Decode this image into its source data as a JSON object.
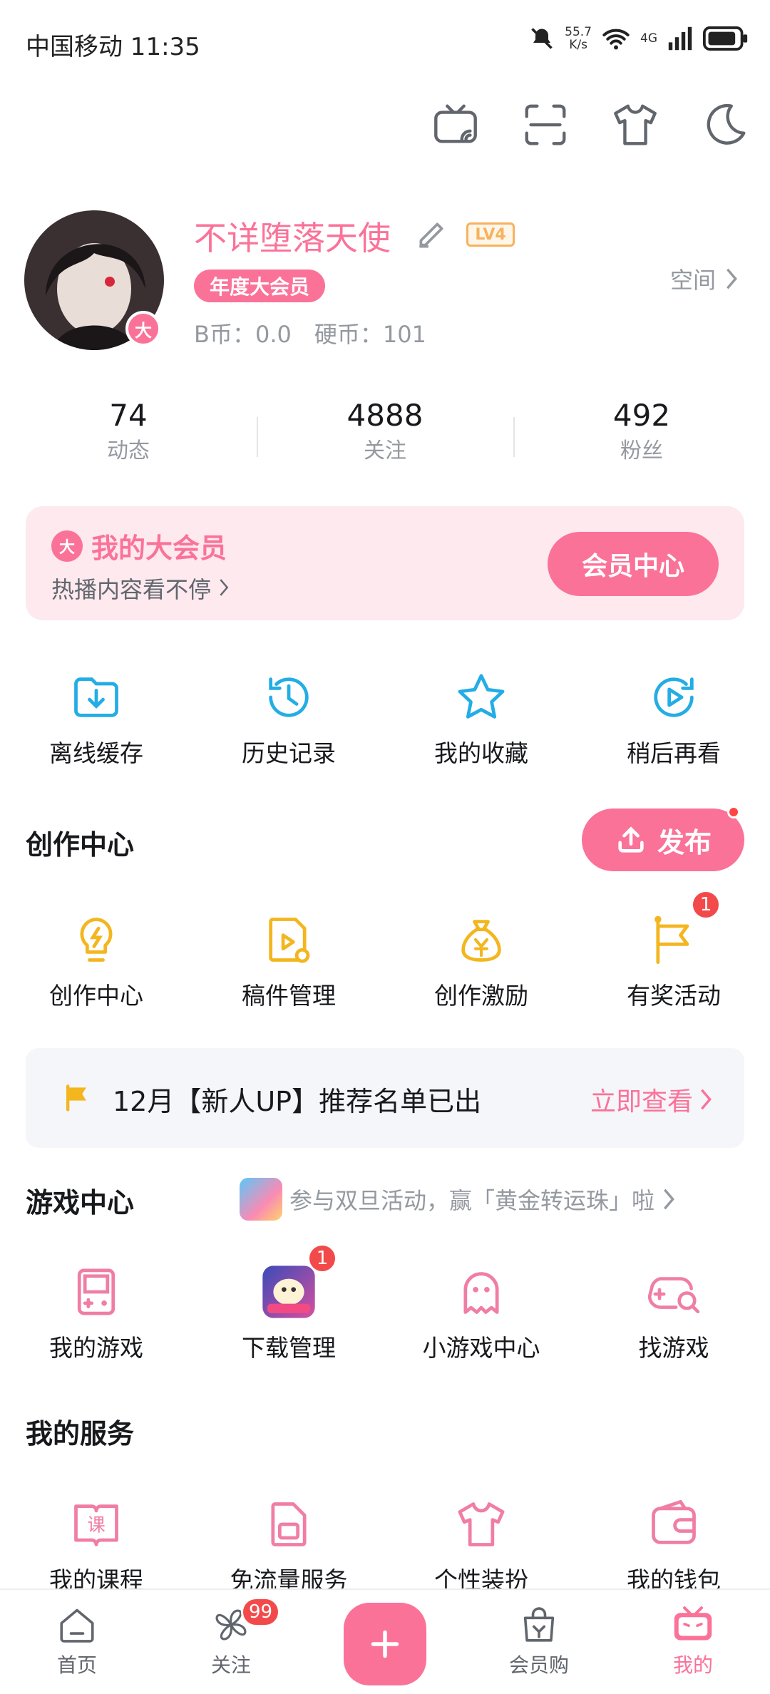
{
  "status_bar": {
    "carrier_time": "中国移动 11:35",
    "net_speed_value": "55.7",
    "net_speed_unit": "K/s",
    "network": "4G"
  },
  "toolbar": {
    "icons": [
      "tv-cast-icon",
      "scan-icon",
      "tshirt-icon",
      "moon-icon"
    ]
  },
  "profile": {
    "username": "不详堕落天使",
    "level": "LV4",
    "vip_tag": "年度大会员",
    "vip_avatar_badge": "大",
    "coins": "B币：0.0　硬币：101",
    "space_label": "空间"
  },
  "stats": [
    {
      "value": "74",
      "label": "动态"
    },
    {
      "value": "4888",
      "label": "关注"
    },
    {
      "value": "492",
      "label": "粉丝"
    }
  ],
  "vip_card": {
    "badge": "大",
    "title": "我的大会员",
    "subtitle": "热播内容看不停",
    "button": "会员中心"
  },
  "quick_actions": [
    {
      "label": "离线缓存",
      "icon": "download-folder-icon"
    },
    {
      "label": "历史记录",
      "icon": "history-clock-icon"
    },
    {
      "label": "我的收藏",
      "icon": "star-icon"
    },
    {
      "label": "稍后再看",
      "icon": "watch-later-icon"
    }
  ],
  "creator": {
    "title": "创作中心",
    "publish_button": "发布",
    "items": [
      {
        "label": "创作中心",
        "icon": "lightbulb-icon"
      },
      {
        "label": "稿件管理",
        "icon": "document-play-icon"
      },
      {
        "label": "创作激励",
        "icon": "money-bag-icon"
      },
      {
        "label": "有奖活动",
        "icon": "flag-icon",
        "badge": "1"
      }
    ]
  },
  "notice": {
    "text": "12月【新人UP】推荐名单已出",
    "link": "立即查看"
  },
  "games": {
    "title": "游戏中心",
    "promo": "参与双旦活动，赢「黄金转运珠」啦",
    "items": [
      {
        "label": "我的游戏",
        "icon": "gameboy-icon"
      },
      {
        "label": "下载管理",
        "icon": "game-app-icon",
        "badge": "1"
      },
      {
        "label": "小游戏中心",
        "icon": "ghost-icon"
      },
      {
        "label": "找游戏",
        "icon": "gamepad-search-icon"
      }
    ]
  },
  "services": {
    "title": "我的服务",
    "items": [
      {
        "label": "我的课程",
        "icon": "course-book-icon",
        "glyph": "课"
      },
      {
        "label": "免流量服务",
        "icon": "sim-card-icon"
      },
      {
        "label": "个性装扮",
        "icon": "tshirt-icon"
      },
      {
        "label": "我的钱包",
        "icon": "wallet-icon"
      }
    ]
  },
  "bottom_nav": {
    "home": "首页",
    "follow": "关注",
    "follow_badge": "99",
    "vip_shop": "会员购",
    "mine": "我的",
    "mine_color": "#fb7299"
  }
}
